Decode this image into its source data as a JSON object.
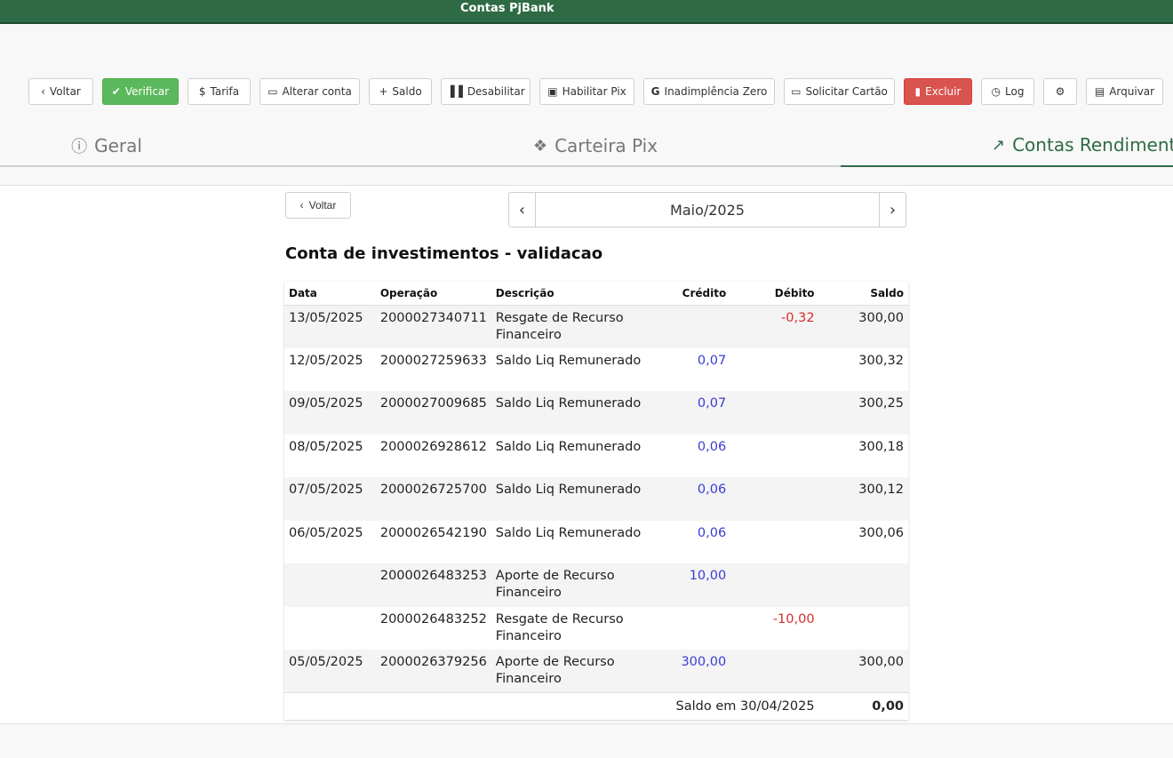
{
  "app": {
    "title": "Contas PjBank"
  },
  "toolbar": {
    "voltar": "Voltar",
    "verificar": "Verificar",
    "tarifa": "Tarifa",
    "alterar_conta": "Alterar conta",
    "saldo": "Saldo",
    "desabilitar": "Desabilitar",
    "habilitar_pix": "Habilitar Pix",
    "inadimplencia": "Inadimplência Zero",
    "solicitar_cartao": "Solicitar Cartão",
    "excluir": "Excluir",
    "log": "Log",
    "arquivar": "Arquivar"
  },
  "tabs": [
    {
      "label": "Geral",
      "icon": "info-icon"
    },
    {
      "label": "Carteira Pix",
      "icon": "pix-icon"
    },
    {
      "label": "Contas Rendimento",
      "icon": "money-growth-icon"
    }
  ],
  "nav": {
    "back": "Voltar",
    "month": "Maio/2025"
  },
  "section": {
    "title": "Conta de investimentos - validacao"
  },
  "table": {
    "headers": {
      "data": "Data",
      "operacao": "Operação",
      "descricao": "Descrição",
      "credito": "Crédito",
      "debito": "Débito",
      "saldo": "Saldo"
    },
    "rows": [
      {
        "data": "13/05/2025",
        "operacao": "2000027340711",
        "descricao": "Resgate de Recurso Financeiro",
        "credito": "",
        "debito": "-0,32",
        "saldo": "300,00"
      },
      {
        "data": "12/05/2025",
        "operacao": "2000027259633",
        "descricao": "Saldo Liq Remunerado",
        "credito": "0,07",
        "debito": "",
        "saldo": "300,32"
      },
      {
        "data": "09/05/2025",
        "operacao": "2000027009685",
        "descricao": "Saldo Liq Remunerado",
        "credito": "0,07",
        "debito": "",
        "saldo": "300,25"
      },
      {
        "data": "08/05/2025",
        "operacao": "2000026928612",
        "descricao": "Saldo Liq Remunerado",
        "credito": "0,06",
        "debito": "",
        "saldo": "300,18"
      },
      {
        "data": "07/05/2025",
        "operacao": "2000026725700",
        "descricao": "Saldo Liq Remunerado",
        "credito": "0,06",
        "debito": "",
        "saldo": "300,12"
      },
      {
        "data": "06/05/2025",
        "operacao": "2000026542190",
        "descricao": "Saldo Liq Remunerado",
        "credito": "0,06",
        "debito": "",
        "saldo": "300,06"
      },
      {
        "data": "",
        "operacao": "2000026483253",
        "descricao": "Aporte de Recurso Financeiro",
        "credito": "10,00",
        "debito": "",
        "saldo": ""
      },
      {
        "data": "",
        "operacao": "2000026483252",
        "descricao": "Resgate de Recurso Financeiro",
        "credito": "",
        "debito": "-10,00",
        "saldo": ""
      },
      {
        "data": "05/05/2025",
        "operacao": "2000026379256",
        "descricao": "Aporte de Recurso Financeiro",
        "credito": "300,00",
        "debito": "",
        "saldo": "300,00"
      }
    ],
    "footer": {
      "label": "Saldo em 30/04/2025",
      "value": "0,00"
    }
  },
  "colors": {
    "brand": "#2e6b45",
    "success": "#5cb85c",
    "danger": "#d9534f",
    "credit": "#3b3bd6",
    "debit": "#d62c2c"
  }
}
